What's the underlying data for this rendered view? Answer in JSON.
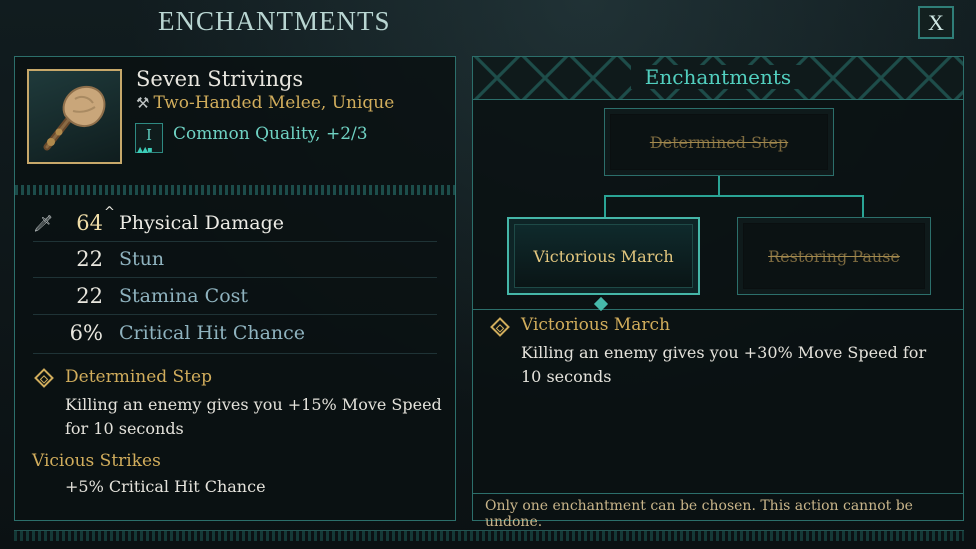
{
  "window": {
    "title": "ENCHANTMENTS",
    "close_label": "X"
  },
  "item": {
    "name": "Seven Strivings",
    "type": "Two-Handed Melee, Unique",
    "quality_tier": "I",
    "quality": "Common Quality, +2/3"
  },
  "stats": [
    {
      "value": "64",
      "up_marker": "^",
      "label": "Physical Damage",
      "icon": "sword-icon"
    },
    {
      "value": "22",
      "label": "Stun"
    },
    {
      "value": "22",
      "label": "Stamina Cost"
    },
    {
      "value": "6%",
      "label": "Critical Hit Chance"
    }
  ],
  "current_enchantment": {
    "name": "Determined Step",
    "description": "Killing an enemy gives you +15% Move Speed for 10 seconds"
  },
  "vicious": {
    "name": "Vicious Strikes",
    "description": "+5% Critical Hit Chance"
  },
  "enchant_panel": {
    "title": "Enchantments",
    "nodes": {
      "root": "Determined Step",
      "left": "Victorious March",
      "right": "Restoring Pause"
    },
    "selected": {
      "name": "Victorious March",
      "description": "Killing an enemy gives you +30% Move Speed for 10 seconds"
    },
    "footer": "Only one enchantment can be chosen. This action cannot be undone."
  },
  "colors": {
    "accent": "#45b6a8",
    "gold": "#d1ad5c",
    "panel_border": "#2c6f6b"
  }
}
